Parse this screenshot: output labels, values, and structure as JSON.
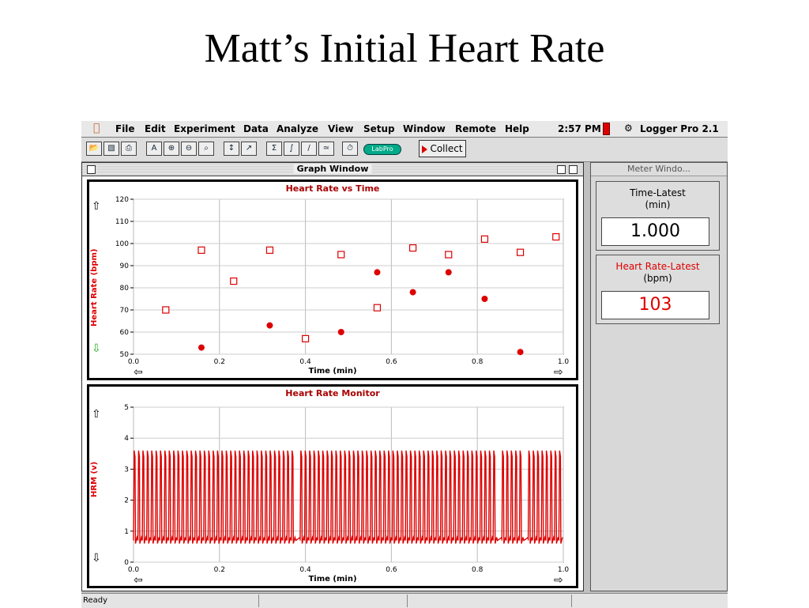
{
  "slide": {
    "title": "Matt’s Initial Heart Rate"
  },
  "menubar": {
    "items": [
      "File",
      "Edit",
      "Experiment",
      "Data",
      "Analyze",
      "View",
      "Setup",
      "Window",
      "Remote",
      "Help"
    ],
    "clock": "2:57 PM",
    "app_name": "Logger Pro 2.1"
  },
  "toolbar": {
    "labpro_label": "LabPro",
    "collect_label": "Collect"
  },
  "graph_window": {
    "title": "Graph Window",
    "top_chart": {
      "title": "Heart Rate vs Time",
      "ylabel": "Heart Rate (bpm)",
      "xlabel": "Time (min)"
    },
    "bottom_chart": {
      "title": "Heart Rate Monitor",
      "ylabel": "HRM (v)",
      "xlabel": "Time (min)"
    }
  },
  "meter_window": {
    "title": "Meter Windo...",
    "meters": [
      {
        "label": "Time-Latest",
        "unit": "(min)",
        "value": "1.000",
        "color": "#000000"
      },
      {
        "label": "Heart Rate-Latest",
        "unit": "(bpm)",
        "value": "103",
        "color": "#dd0000"
      }
    ]
  },
  "status": {
    "text": "Ready"
  },
  "chart_data": [
    {
      "type": "scatter",
      "title": "Heart Rate vs Time",
      "xlabel": "Time (min)",
      "ylabel": "Heart Rate (bpm)",
      "xlim": [
        0,
        1.0
      ],
      "ylim": [
        50,
        120
      ],
      "xticks": [
        "0.0",
        "0.2",
        "0.4",
        "0.6",
        "0.8",
        "1.0"
      ],
      "yticks": [
        "50",
        "60",
        "70",
        "80",
        "90",
        "100",
        "110",
        "120"
      ],
      "grid": true,
      "series": [
        {
          "marker": "open-square",
          "color": "#dd0000",
          "x": [
            0.075,
            0.158,
            0.233,
            0.317,
            0.4,
            0.483,
            0.567,
            0.65,
            0.733,
            0.817,
            0.9,
            0.983
          ],
          "y": [
            70,
            97,
            83,
            97,
            57,
            95,
            71,
            98,
            95,
            102,
            96,
            103
          ]
        },
        {
          "marker": "filled-circle",
          "color": "#dd0000",
          "x": [
            0.158,
            0.317,
            0.483,
            0.567,
            0.65,
            0.733,
            0.817,
            0.9
          ],
          "y": [
            53,
            63,
            60,
            87,
            78,
            87,
            75,
            51
          ]
        }
      ]
    },
    {
      "type": "line",
      "title": "Heart Rate Monitor",
      "xlabel": "Time (min)",
      "ylabel": "HRM (v)",
      "xlim": [
        0,
        1.0
      ],
      "ylim": [
        0,
        5
      ],
      "xticks": [
        "0.0",
        "0.2",
        "0.4",
        "0.6",
        "0.8",
        "1.0"
      ],
      "yticks": [
        "0",
        "1",
        "2",
        "3",
        "4",
        "5"
      ],
      "grid": true,
      "color": "#dd0000",
      "waveform": {
        "baseline_v": 0.7,
        "peak_v": 3.6,
        "pulse_count": 98,
        "gaps_min": [
          [
            0.375,
            0.38
          ],
          [
            0.84,
            0.85
          ],
          [
            0.905,
            0.91
          ]
        ]
      }
    }
  ]
}
